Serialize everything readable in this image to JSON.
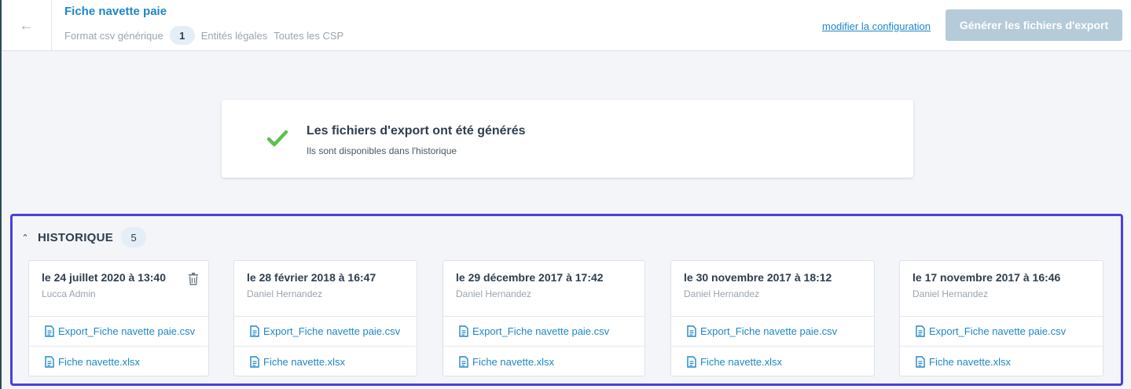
{
  "header": {
    "back_icon": "arrow-left-icon",
    "title": "Fiche navette paie",
    "format": "Format csv générique",
    "entity_count": "1",
    "entities_label": "Entités légales",
    "csp_label": "Toutes les CSP",
    "config_link": "modifier la configuration",
    "export_button": "Générer les fichiers d'export"
  },
  "success": {
    "icon": "check-icon",
    "title": "Les fichiers d'export ont été générés",
    "subtitle": "Ils sont disponibles dans l'historique"
  },
  "history": {
    "title": "HISTORIQUE",
    "count": "5",
    "items": [
      {
        "date": "le 24 juillet 2020 à 13:40",
        "author": "Lucca Admin",
        "deletable": true,
        "files": [
          "Export_Fiche navette paie.csv",
          "Fiche navette.xlsx"
        ]
      },
      {
        "date": "le 28 février 2018 à 16:47",
        "author": "Daniel Hernandez",
        "deletable": false,
        "files": [
          "Export_Fiche navette paie.csv",
          "Fiche navette.xlsx"
        ]
      },
      {
        "date": "le 29 décembre 2017 à 17:42",
        "author": "Daniel Hernandez",
        "deletable": false,
        "files": [
          "Export_Fiche navette paie.csv",
          "Fiche navette.xlsx"
        ]
      },
      {
        "date": "le 30 novembre 2017 à 18:12",
        "author": "Daniel Hernandez",
        "deletable": false,
        "files": [
          "Export_Fiche navette paie.csv",
          "Fiche navette.xlsx"
        ]
      },
      {
        "date": "le 17 novembre 2017 à 16:46",
        "author": "Daniel Hernandez",
        "deletable": false,
        "files": [
          "Export_Fiche navette paie.csv",
          "Fiche navette.xlsx"
        ]
      }
    ]
  },
  "colors": {
    "accent": "#1d87c8",
    "success": "#5cc24a",
    "highlight_border": "#4b3fe0",
    "disabled_button": "#b5cbd9"
  }
}
